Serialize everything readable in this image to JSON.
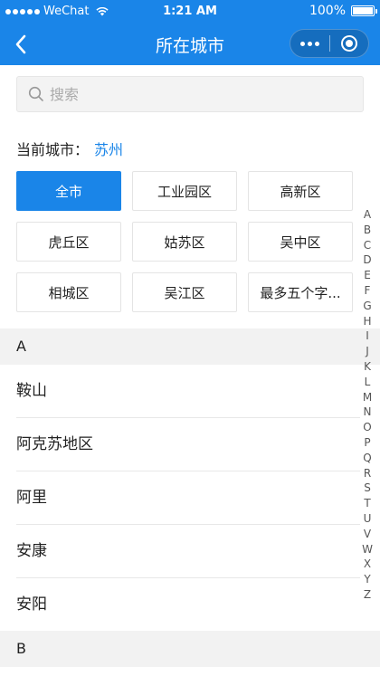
{
  "status_bar": {
    "carrier": "WeChat",
    "time": "1:21 AM",
    "battery": "100%"
  },
  "nav": {
    "title": "所在城市"
  },
  "search": {
    "placeholder": "搜索"
  },
  "current_city": {
    "label": "当前城市：",
    "name": "苏州"
  },
  "districts": [
    {
      "label": "全市",
      "active": true
    },
    {
      "label": "工业园区",
      "active": false
    },
    {
      "label": "高新区",
      "active": false
    },
    {
      "label": "虎丘区",
      "active": false
    },
    {
      "label": "姑苏区",
      "active": false
    },
    {
      "label": "吴中区",
      "active": false
    },
    {
      "label": "相城区",
      "active": false
    },
    {
      "label": "吴江区",
      "active": false
    },
    {
      "label": "最多五个字...",
      "active": false
    }
  ],
  "sections": [
    {
      "letter": "A",
      "cities": [
        "鞍山",
        "阿克苏地区",
        "阿里",
        "安康",
        "安阳"
      ]
    },
    {
      "letter": "B",
      "cities": []
    }
  ],
  "index_letters": [
    "A",
    "B",
    "C",
    "D",
    "E",
    "F",
    "G",
    "H",
    "I",
    "J",
    "K",
    "L",
    "M",
    "N",
    "O",
    "P",
    "Q",
    "R",
    "S",
    "T",
    "U",
    "V",
    "W",
    "X",
    "Y",
    "Z"
  ],
  "colors": {
    "primary": "#1a85e8",
    "section_bg": "#f2f2f2"
  }
}
